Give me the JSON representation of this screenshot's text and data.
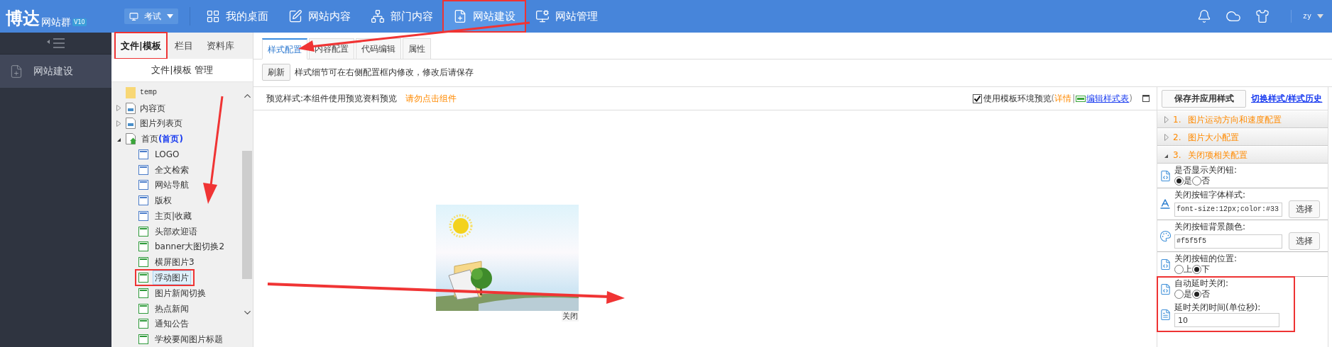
{
  "header": {
    "logo": "博达",
    "product": "网站群",
    "version": "V10",
    "site_selector": "考试",
    "nav": [
      {
        "label": "我的桌面",
        "kind": "desktop",
        "selected": false,
        "annotated": false
      },
      {
        "label": "网站内容",
        "kind": "content",
        "selected": false,
        "annotated": false
      },
      {
        "label": "部门内容",
        "kind": "department",
        "selected": false,
        "annotated": false
      },
      {
        "label": "网站建设",
        "kind": "build",
        "selected": true,
        "annotated": true
      },
      {
        "label": "网站管理",
        "kind": "manage",
        "selected": false,
        "annotated": false
      }
    ],
    "user": "zy"
  },
  "sidebar": {
    "items": [
      {
        "label": "网站建设",
        "selected": true
      }
    ]
  },
  "tree": {
    "tabs": [
      {
        "label": "文件|模板",
        "selected": true,
        "annotated": true
      },
      {
        "label": "栏目",
        "selected": false,
        "annotated": false
      },
      {
        "label": "资料库",
        "selected": false,
        "annotated": false
      }
    ],
    "title": "文件|模板 管理",
    "items": [
      {
        "label": "temp",
        "kind": "folder"
      },
      {
        "label": "内容页",
        "kind": "page",
        "expanded": false
      },
      {
        "label": "图片列表页",
        "kind": "page",
        "expanded": false
      },
      {
        "label": "首页",
        "tag": "(首页)",
        "kind": "home",
        "expanded": true,
        "children": [
          {
            "label": "LOGO",
            "color": "#4a7cc9",
            "selected": false,
            "annotated": false
          },
          {
            "label": "全文检索",
            "color": "#4a7cc9",
            "selected": false,
            "annotated": false
          },
          {
            "label": "网站导航",
            "color": "#4a7cc9",
            "selected": false,
            "annotated": false
          },
          {
            "label": "版权",
            "color": "#4a7cc9",
            "selected": false,
            "annotated": false
          },
          {
            "label": "主页|收藏",
            "color": "#4a7cc9",
            "selected": false,
            "annotated": false
          },
          {
            "label": "头部欢迎语",
            "color": "#2e9a3a",
            "selected": false,
            "annotated": false
          },
          {
            "label": "banner大图切换2",
            "color": "#2e9a3a",
            "selected": false,
            "annotated": false
          },
          {
            "label": "横屏图片3",
            "color": "#2e9a3a",
            "selected": false,
            "annotated": false
          },
          {
            "label": "浮动图片",
            "color": "#2e9a3a",
            "selected": true,
            "annotated": true
          },
          {
            "label": "图片新闻切换",
            "color": "#2e9a3a",
            "selected": false,
            "annotated": false
          },
          {
            "label": "热点新闻",
            "color": "#2e9a3a",
            "selected": false,
            "annotated": false
          },
          {
            "label": "通知公告",
            "color": "#2e9a3a",
            "selected": false,
            "annotated": false
          },
          {
            "label": "学校要闻图片标题",
            "color": "#2e9a3a",
            "selected": false,
            "annotated": false
          }
        ]
      }
    ]
  },
  "main": {
    "tabs": [
      {
        "label": "样式配置",
        "selected": true
      },
      {
        "label": "内容配置",
        "selected": false
      },
      {
        "label": "代码编辑",
        "selected": false
      },
      {
        "label": "属性",
        "selected": false
      }
    ],
    "refresh_button": "刷新",
    "hint": "样式细节可在右侧配置框内修改，修改后请保存"
  },
  "preview": {
    "label": "预览样式:本组件使用预览资料预览",
    "warning": "请勿点击组件",
    "checkbox": {
      "label": "使用模板环境预览",
      "checked": true
    },
    "open_paren": "(",
    "detail_link": "详情",
    "separator": "|",
    "edit_link": "编辑样式表",
    "close_paren": ")",
    "close_label": "关闭"
  },
  "config": {
    "save_button": "保存并应用样式",
    "history_link": "切换样式/样式历史",
    "sections": [
      {
        "number": "1.",
        "title": "图片运动方向和速度配置",
        "expanded": false
      },
      {
        "number": "2.",
        "title": "图片大小配置",
        "expanded": false
      },
      {
        "number": "3.",
        "title": "关闭项相关配置",
        "expanded": true,
        "fields": [
          {
            "kind": "radio",
            "label": "是否显示关闭钮:",
            "annotated": false,
            "options": [
              {
                "label": "是",
                "selected": true
              },
              {
                "label": "否",
                "selected": false
              }
            ]
          },
          {
            "kind": "font_picker",
            "label": "关闭按钮字体样式:",
            "value": "font-size:12px;color:#33",
            "button": "选择",
            "annotated": false
          },
          {
            "kind": "color_picker",
            "label": "关闭按钮背景颜色:",
            "value": "#f5f5f5",
            "button": "选择",
            "annotated": false
          },
          {
            "kind": "radio",
            "label": "关闭按钮的位置:",
            "annotated": false,
            "options": [
              {
                "label": "上",
                "selected": false
              },
              {
                "label": "下",
                "selected": true
              }
            ]
          },
          {
            "kind": "radio",
            "label": "自动延时关闭:",
            "annotated": true,
            "options": [
              {
                "label": "是",
                "selected": false
              },
              {
                "label": "否",
                "selected": true
              }
            ]
          },
          {
            "kind": "number",
            "label": "延时关闭时间(单位秒):",
            "value": "10",
            "annotated": true
          }
        ]
      }
    ]
  }
}
